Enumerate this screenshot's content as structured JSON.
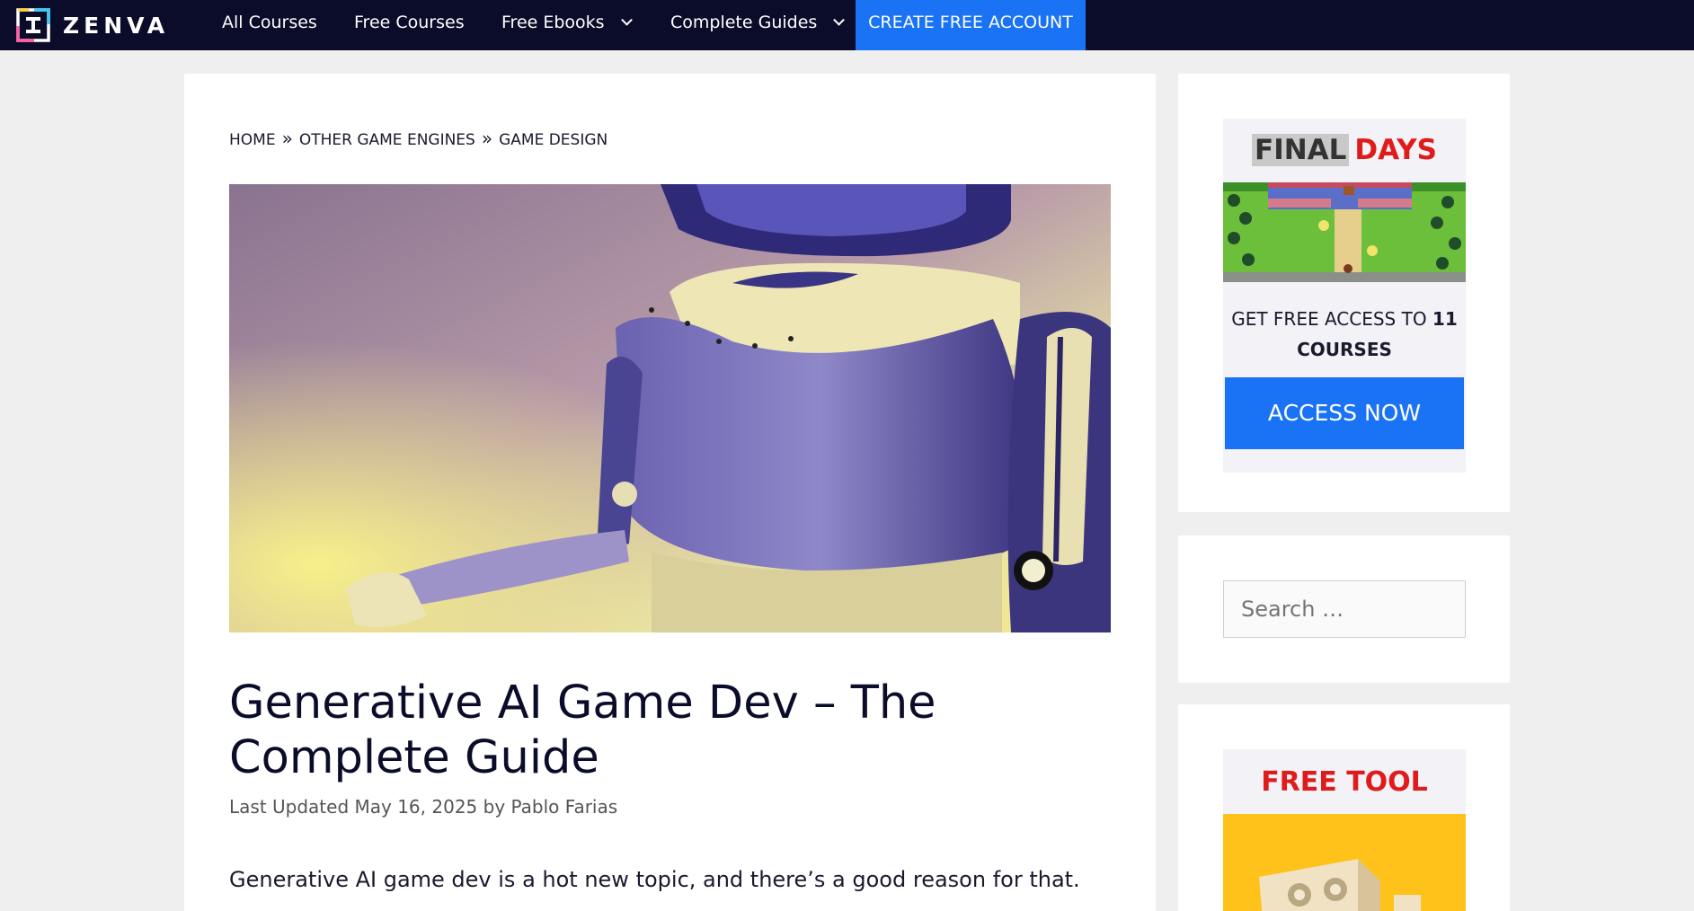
{
  "nav": {
    "logo_text": "ZENVA",
    "links": [
      {
        "label": "All Courses"
      },
      {
        "label": "Free Courses"
      },
      {
        "label": "Free Ebooks"
      },
      {
        "label": "Complete Guides"
      }
    ],
    "cta_label": "CREATE FREE ACCOUNT"
  },
  "breadcrumb": {
    "items": [
      "HOME",
      "OTHER GAME ENGINES",
      "GAME DESIGN"
    ],
    "separator": "»"
  },
  "article": {
    "title": "Generative AI Game Dev – The Complete Guide",
    "meta": "Last Updated May 16, 2025 by Pablo Farias",
    "intro": "Generative AI game dev is a hot new topic, and there’s a good reason for that."
  },
  "sidebar": {
    "promo": {
      "heading_1": "FINAL",
      "heading_2": "DAYS",
      "text_prefix": "GET FREE ACCESS TO ",
      "text_bold": "11 COURSES",
      "button_label": "ACCESS NOW"
    },
    "search": {
      "placeholder": "Search …"
    },
    "tool": {
      "title": "FREE TOOL"
    }
  },
  "colors": {
    "nav_bg": "#0b0c2a",
    "accent_blue": "#1a73f5",
    "accent_red": "#e01b1b"
  }
}
